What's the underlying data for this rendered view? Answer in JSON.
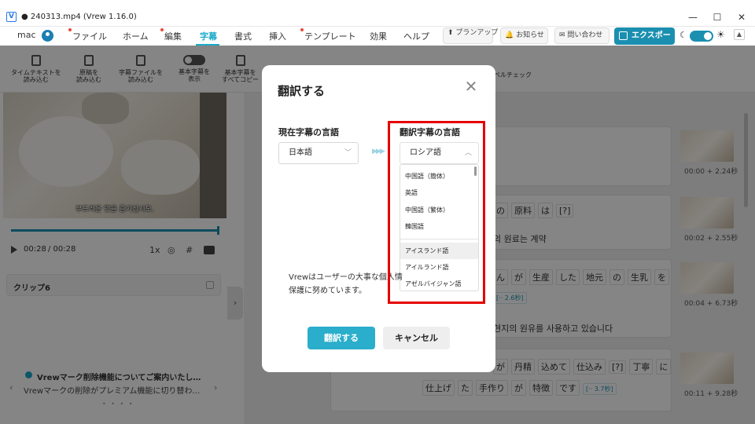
{
  "window": {
    "title": "● 240313.mp4 (Vrew 1.16.0)",
    "logo": "V",
    "controls": [
      "—",
      "☐",
      "✕"
    ]
  },
  "menubar": {
    "account": "mac",
    "items": [
      "ファイル",
      "ホーム",
      "編集",
      "字幕",
      "書式",
      "挿入",
      "テンプレート",
      "効果",
      "ヘルプ"
    ],
    "active": "字幕",
    "plan_update": "プランアップ",
    "news": "お知らせ",
    "contact": "問い合わせ",
    "export": "エクスポート"
  },
  "toolbar": {
    "items": [
      {
        "label1": "タイムテキストを",
        "label2": "読み込む"
      },
      {
        "label1": "原稿を",
        "label2": "読み込む"
      },
      {
        "label1": "字幕ファイルを",
        "label2": "読み込む"
      },
      {
        "label1": "基本字幕を",
        "label2": "表示"
      },
      {
        "label1": "基本字幕を",
        "label2": "すべてコピー"
      }
    ],
    "spellcheck": "ペルチェック"
  },
  "player": {
    "subtitle": "부드러운 맛을 즐기십시오.",
    "current_time": "00:28",
    "total_time": "/ 00:28",
    "speed": "1x",
    "progress": 1.0
  },
  "clip": {
    "label": "クリップ6"
  },
  "notice": {
    "title": "Vrewマーク削除機能についてご案内いたし…",
    "body": "Vrewマークの削除がプレミアム機能に切り替わ…",
    "prev": "‹",
    "next": "›",
    "dots": "• • • •"
  },
  "subtitle_rows": [
    {
      "words_partial": "",
      "translation": "",
      "timestamp": "00:00 + 2.24秒"
    },
    {
      "words": [
        "の",
        "原料",
        "は",
        "[?]"
      ],
      "translation": "의 원료는 계약",
      "timestamp": "00:02 + 2.55秒"
    },
    {
      "words": [
        "さん",
        "が",
        "生産",
        "した",
        "地元",
        "の",
        "生乳",
        "を"
      ],
      "tag": "[·· 2.6秒]",
      "translation": "현지의 원유를 사용하고 있습니다",
      "timestamp": "00:04 + 6.73秒"
    },
    {
      "words": [
        "が",
        "丹精",
        "込めて",
        "仕込み",
        "[?]",
        "丁寧",
        "に"
      ],
      "words2": [
        "仕上げ",
        "た",
        "手作り",
        "が",
        "特徴",
        "です"
      ],
      "tag": "[·· 3.7秒]",
      "timestamp": "00:11 + 9.28秒"
    }
  ],
  "modal": {
    "title": "翻訳する",
    "close": "✕",
    "source_label": "現在字幕の言語",
    "source_value": "日本語",
    "target_label": "翻訳字幕の言語",
    "target_value": "ロシア語",
    "options_top": [
      "中国語（簡体）",
      "英語",
      "中国語（繁体）",
      "韓国語"
    ],
    "options_rest": [
      "アイスランド語",
      "アイルランド語",
      "アゼルバイジャン語"
    ],
    "highlighted": "アイスランド語",
    "privacy_line1": "Vrewはユーザーの大事な個人情",
    "privacy_line2": "保護に努めています。",
    "translate_button": "翻訳する",
    "cancel_button": "キャンセル"
  },
  "colors": {
    "accent": "#2aaecb",
    "export": "#1a8fb0",
    "highlight_box": "#e50000"
  }
}
